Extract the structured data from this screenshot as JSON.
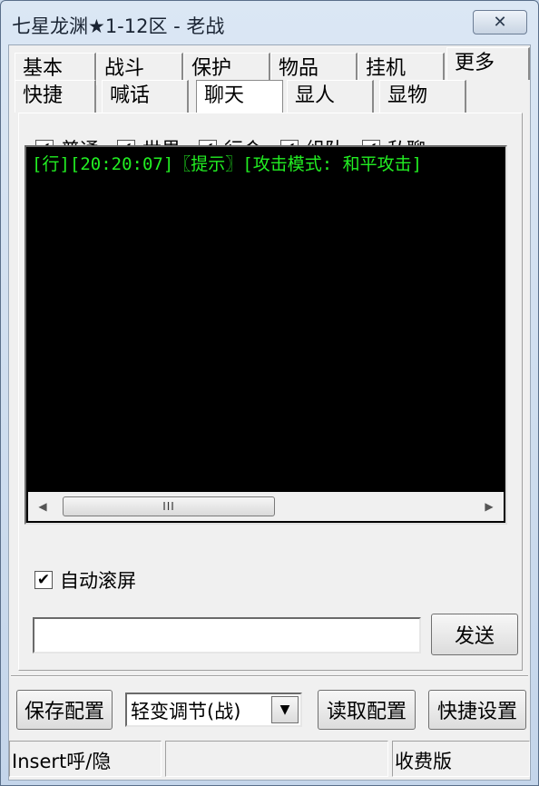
{
  "window": {
    "title": "七星龙渊★1-12区 - 老战",
    "close_glyph": "✕"
  },
  "tabs": {
    "row1": [
      "基本",
      "战斗",
      "保护",
      "物品",
      "挂机",
      "更多"
    ],
    "row2": [
      "快捷",
      "喊话",
      "聊天",
      "显人",
      "显物"
    ],
    "active": "聊天"
  },
  "filters": [
    {
      "label": "普通",
      "checked": true
    },
    {
      "label": "世界",
      "checked": true
    },
    {
      "label": "行会",
      "checked": true
    },
    {
      "label": "组队",
      "checked": true
    },
    {
      "label": "私聊",
      "checked": true
    }
  ],
  "chat": {
    "lines": [
      "[行][20:20:07]〖提示〗[攻击模式: 和平攻击]"
    ],
    "text_color": "#22ee22",
    "scroll_thumb_grip": "III"
  },
  "auto_scroll": {
    "label": "自动滚屏",
    "checked": true
  },
  "send": {
    "input_value": "",
    "button_label": "发送"
  },
  "bottom": {
    "save_label": "保存配置",
    "config_selected": "轻变调节(战)",
    "load_label": "读取配置",
    "hotkey_label": "快捷设置"
  },
  "status": {
    "hotkey_hint": "Insert呼/隐",
    "middle": "",
    "edition": "收费版"
  },
  "icons": {
    "check": "✔",
    "scroll_left": "◀",
    "scroll_right": "▶",
    "dropdown": "▼"
  }
}
